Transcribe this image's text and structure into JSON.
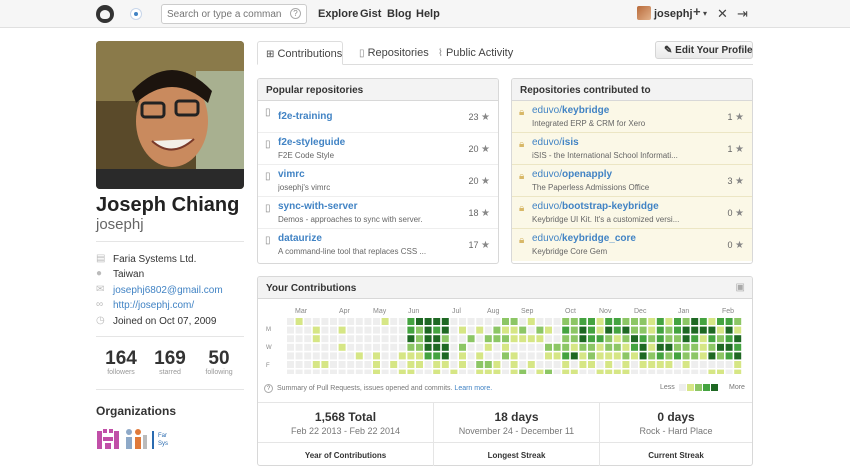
{
  "header": {
    "search_placeholder": "Search or type a command",
    "nav": [
      "Explore",
      "Gist",
      "Blog",
      "Help"
    ],
    "username": "josephj",
    "plus_label": "+",
    "caret": "▾"
  },
  "profile": {
    "fullname": "Joseph Chiang",
    "login": "josephj",
    "details": [
      {
        "icon": "organization-icon",
        "text": "Faria Systems Ltd."
      },
      {
        "icon": "location-icon",
        "text": "Taiwan"
      },
      {
        "icon": "mail-icon",
        "text": "josephj6802@gmail.com"
      },
      {
        "icon": "link-icon",
        "text": "http://josephj.com/"
      },
      {
        "icon": "clock-icon",
        "text": "Joined on Oct 07, 2009"
      }
    ],
    "stats": [
      {
        "value": "164",
        "label": "followers"
      },
      {
        "value": "169",
        "label": "starred"
      },
      {
        "value": "50",
        "label": "following"
      }
    ],
    "organizations_title": "Organizations",
    "org_faria_text": "Far Sys"
  },
  "tabs": {
    "contributions": "Contributions",
    "repositories": "Repositories",
    "activity": "Public Activity",
    "edit_profile": "Edit Your Profile"
  },
  "popular": {
    "title": "Popular repositories",
    "repos": [
      {
        "name": "f2e-training",
        "desc": "",
        "stars": "23"
      },
      {
        "name": "f2e-styleguide",
        "desc": "F2E Code Style",
        "stars": "20"
      },
      {
        "name": "vimrc",
        "desc": "josephj's vimrc",
        "stars": "20"
      },
      {
        "name": "sync-with-server",
        "desc": "Demos - approaches to sync with server.",
        "stars": "18"
      },
      {
        "name": "dataurize",
        "desc": "A command-line tool that replaces CSS ...",
        "stars": "17"
      }
    ]
  },
  "contributed": {
    "title": "Repositories contributed to",
    "repos": [
      {
        "owner": "eduvo/",
        "name": "keybridge",
        "desc": "Integrated ERP & CRM for Xero",
        "stars": "1"
      },
      {
        "owner": "eduvo/",
        "name": "isis",
        "desc": "iSIS - the International School Informati...",
        "stars": "1"
      },
      {
        "owner": "eduvo/",
        "name": "openapply",
        "desc": "The Paperless Admissions Office",
        "stars": "3"
      },
      {
        "owner": "eduvo/",
        "name": "bootstrap-keybridge",
        "desc": "Keybridge UI Kit. It's a customized versi...",
        "stars": "0"
      },
      {
        "owner": "eduvo/",
        "name": "keybridge_core",
        "desc": "Keybridge Core Gem",
        "stars": "0"
      }
    ]
  },
  "contributions": {
    "title": "Your Contributions",
    "months": [
      "Mar",
      "Apr",
      "May",
      "Jun",
      "Jul",
      "Aug",
      "Sep",
      "Oct",
      "Nov",
      "Dec",
      "Jan",
      "Feb"
    ],
    "days": [
      "M",
      "W",
      "F"
    ],
    "summary": "Summary of Pull Requests, issues opened and commits.",
    "learn_more": "Learn more.",
    "legend_less": "Less",
    "legend_more": "More",
    "colors": [
      "#eeeeee",
      "#d6e685",
      "#8cc665",
      "#44a340",
      "#1e6823"
    ],
    "stats": [
      {
        "value": "1,568 Total",
        "range": "Feb 22 2013 - Feb 22 2014",
        "label": "Year of Contributions"
      },
      {
        "value": "18 days",
        "range": "November 24 - December 11",
        "label": "Longest Streak"
      },
      {
        "value": "0 days",
        "range": "Rock - Hard Place",
        "label": "Current Streak"
      }
    ]
  }
}
